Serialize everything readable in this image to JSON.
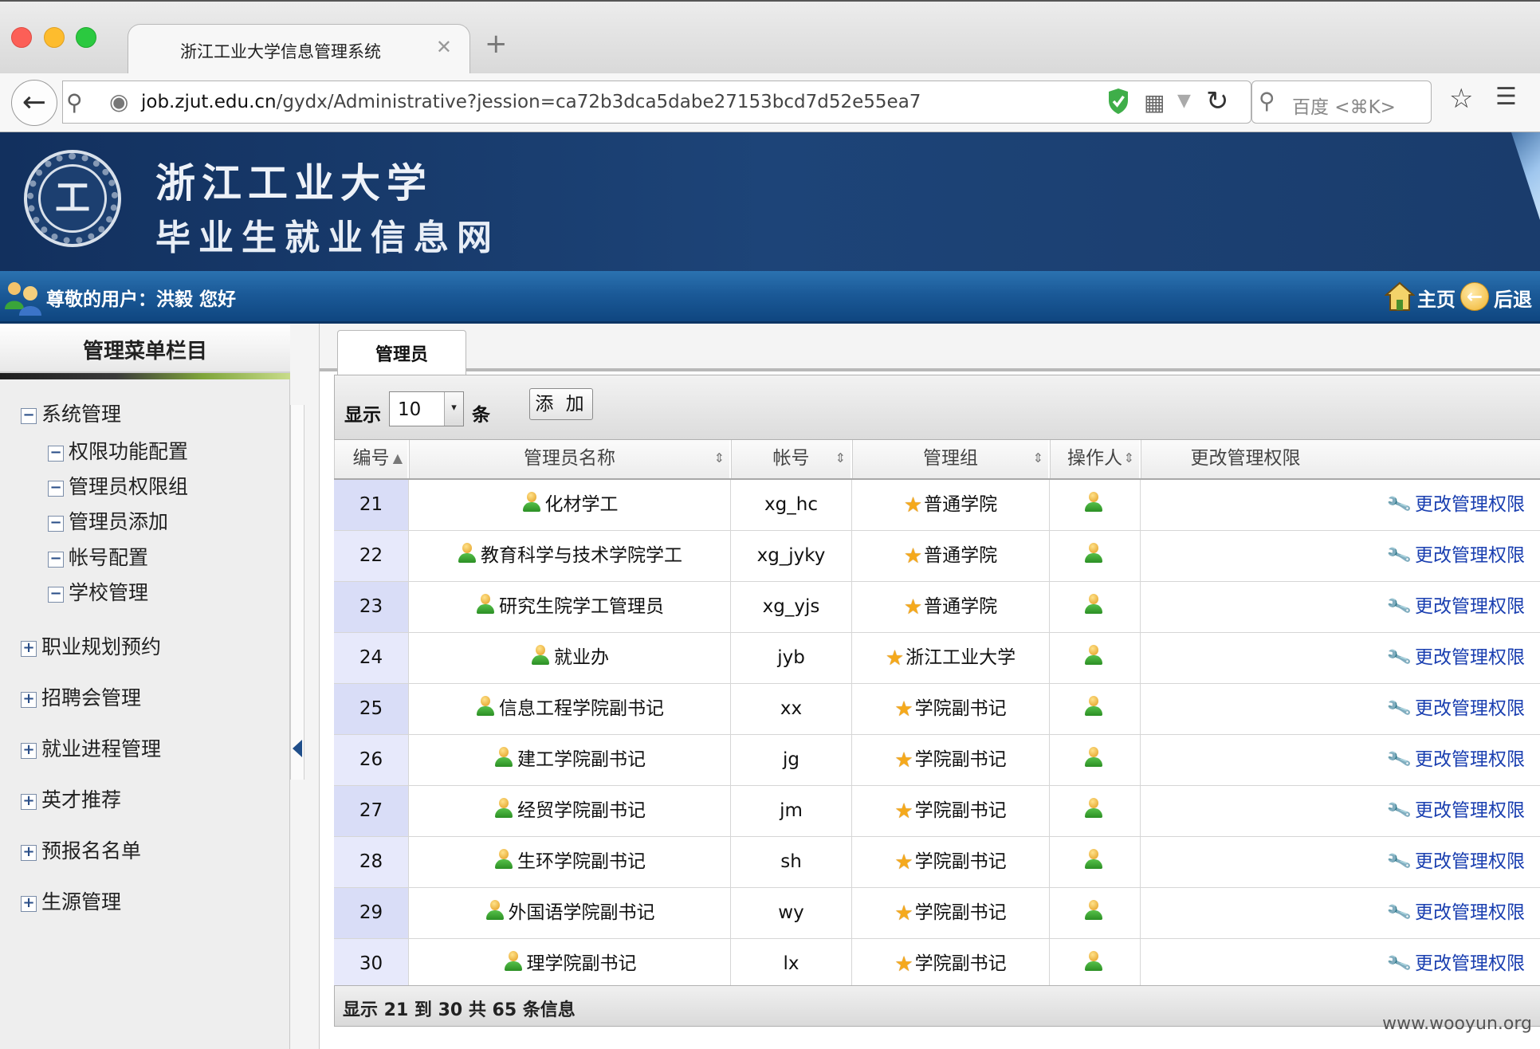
{
  "browser": {
    "tab_title": "浙江工业大学信息管理系统",
    "close_glyph": "✕",
    "new_tab_glyph": "+",
    "url_host": "job.zjut.edu.cn",
    "url_path": "/gydx/Administrative?jession=ca72b3dca5dabe27153bcd7d52e55ea7",
    "search_placeholder": "百度 <⌘K>"
  },
  "site": {
    "seal_glyph": "工",
    "name": "浙江工业大学",
    "subtitle": "毕业生就业信息网"
  },
  "userbar": {
    "greeting": "尊敬的用户：洪毅 您好",
    "home": "主页",
    "back": "后退"
  },
  "sidebar": {
    "title": "管理菜单栏目",
    "groups": [
      {
        "label": "系统管理",
        "toggle": "−",
        "children": [
          "权限功能配置",
          "管理员权限组",
          "管理员添加",
          "帐号配置",
          "学校管理"
        ]
      },
      {
        "label": "职业规划预约",
        "toggle": "+"
      },
      {
        "label": "招聘会管理",
        "toggle": "+"
      },
      {
        "label": "就业进程管理",
        "toggle": "+"
      },
      {
        "label": "英才推荐",
        "toggle": "+"
      },
      {
        "label": "预报名名单",
        "toggle": "+"
      },
      {
        "label": "生源管理",
        "toggle": "+"
      }
    ]
  },
  "main": {
    "tab": "管理员",
    "show_label": "显示",
    "page_size": "10",
    "rows_label": "条",
    "add_label": "添 加",
    "columns": [
      "编号",
      "管理员名称",
      "帐号",
      "管理组",
      "操作人",
      "更改管理权限"
    ],
    "rows": [
      {
        "id": "21",
        "name": "化材学工",
        "account": "xg_hc",
        "group": "普通学院",
        "action": "更改管理权限"
      },
      {
        "id": "22",
        "name": "教育科学与技术学院学工",
        "account": "xg_jyky",
        "group": "普通学院",
        "action": "更改管理权限"
      },
      {
        "id": "23",
        "name": "研究生院学工管理员",
        "account": "xg_yjs",
        "group": "普通学院",
        "action": "更改管理权限"
      },
      {
        "id": "24",
        "name": "就业办",
        "account": "jyb",
        "group": "浙江工业大学",
        "action": "更改管理权限"
      },
      {
        "id": "25",
        "name": "信息工程学院副书记",
        "account": "xx",
        "group": "学院副书记",
        "action": "更改管理权限"
      },
      {
        "id": "26",
        "name": "建工学院副书记",
        "account": "jg",
        "group": "学院副书记",
        "action": "更改管理权限"
      },
      {
        "id": "27",
        "name": "经贸学院副书记",
        "account": "jm",
        "group": "学院副书记",
        "action": "更改管理权限"
      },
      {
        "id": "28",
        "name": "生环学院副书记",
        "account": "sh",
        "group": "学院副书记",
        "action": "更改管理权限"
      },
      {
        "id": "29",
        "name": "外国语学院副书记",
        "account": "wy",
        "group": "学院副书记",
        "action": "更改管理权限"
      },
      {
        "id": "30",
        "name": "理学院副书记",
        "account": "lx",
        "group": "学院副书记",
        "action": "更改管理权限"
      }
    ],
    "info": "显示 21 到 30 共 65 条信息"
  },
  "watermark": "www.wooyun.org",
  "icons": {
    "sort_asc": "▲",
    "sort_both": "⇕",
    "dropdown": "▾",
    "star": "★",
    "wrench": "🔧"
  },
  "colors": {
    "banner": "#1d4478",
    "userbar": "#1b5a98",
    "link": "#1a3fb0",
    "id_cell": "#e7e9fb"
  }
}
